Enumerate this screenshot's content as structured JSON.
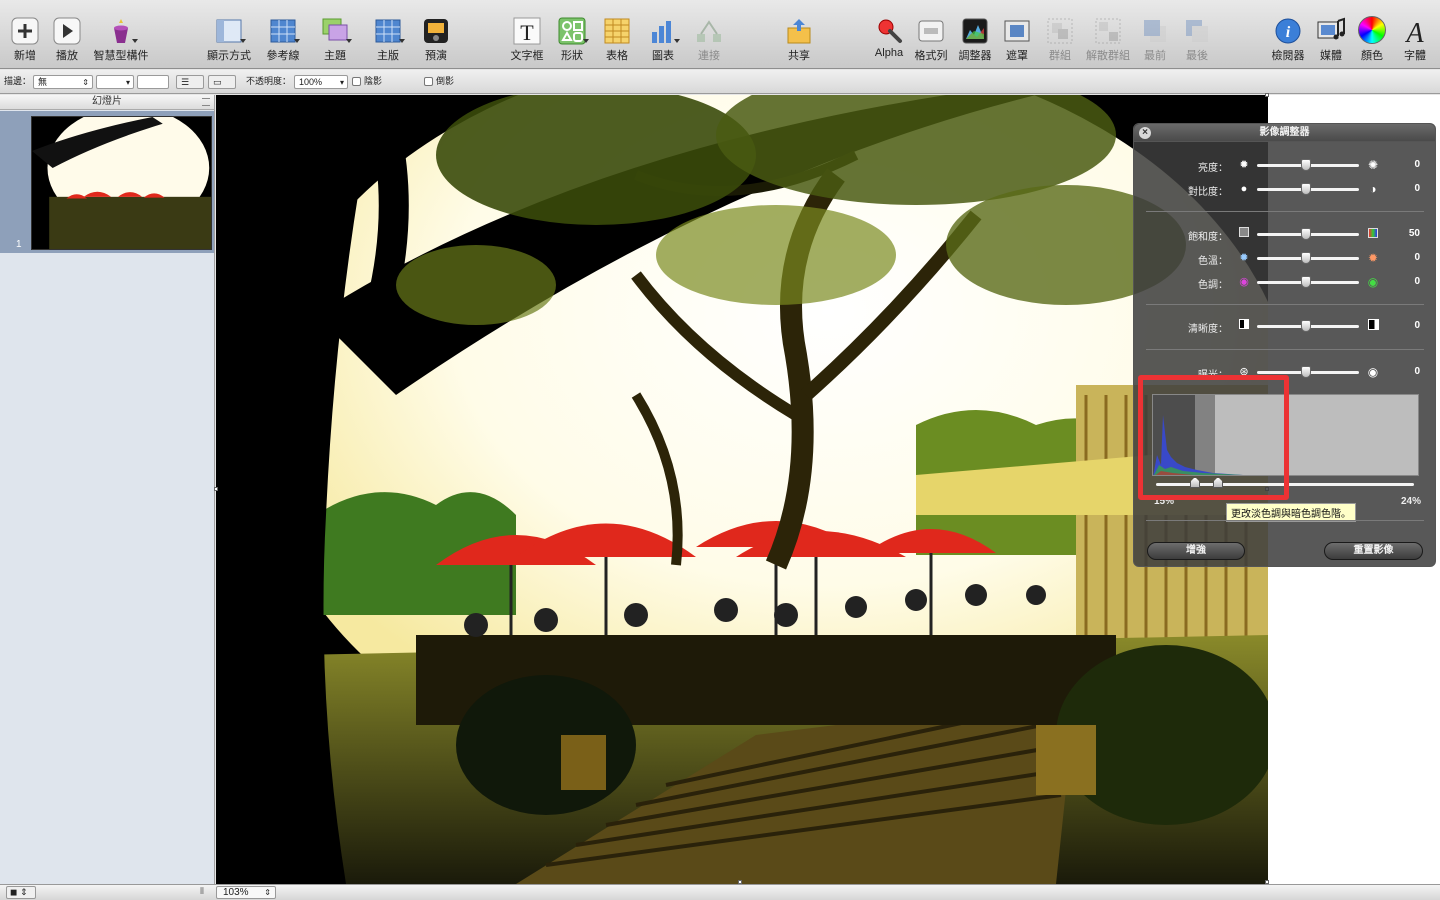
{
  "toolbar": {
    "items": [
      {
        "label": "新增",
        "icon": "plus-icon"
      },
      {
        "label": "播放",
        "icon": "play-icon"
      },
      {
        "label": "智慧型構件",
        "icon": "smart-builds-icon"
      },
      {
        "label": "顯示方式",
        "icon": "view-icon"
      },
      {
        "label": "參考線",
        "icon": "guides-icon"
      },
      {
        "label": "主題",
        "icon": "themes-icon"
      },
      {
        "label": "主版",
        "icon": "masters-icon"
      },
      {
        "label": "預演",
        "icon": "rehearse-icon"
      },
      {
        "label": "文字框",
        "icon": "text-box-icon"
      },
      {
        "label": "形狀",
        "icon": "shapes-icon"
      },
      {
        "label": "表格",
        "icon": "table-icon"
      },
      {
        "label": "圖表",
        "icon": "chart-icon"
      },
      {
        "label": "連接",
        "icon": "connect-icon"
      },
      {
        "label": "共享",
        "icon": "share-icon"
      },
      {
        "label": "Alpha",
        "icon": "alpha-icon"
      },
      {
        "label": "格式列",
        "icon": "format-bar-icon"
      },
      {
        "label": "調整器",
        "icon": "adjust-icon"
      },
      {
        "label": "遮罩",
        "icon": "mask-icon"
      },
      {
        "label": "群組",
        "icon": "group-icon"
      },
      {
        "label": "解散群組",
        "icon": "ungroup-icon"
      },
      {
        "label": "最前",
        "icon": "front-icon"
      },
      {
        "label": "最後",
        "icon": "back-icon"
      },
      {
        "label": "檢閱器",
        "icon": "inspector-icon"
      },
      {
        "label": "媒體",
        "icon": "media-icon"
      },
      {
        "label": "顏色",
        "icon": "colors-icon"
      },
      {
        "label": "字體",
        "icon": "fonts-icon"
      }
    ]
  },
  "formatbar": {
    "stroke_label": "描邊：",
    "stroke_value": "無",
    "opacity_label": "不透明度：",
    "opacity_value": "100%",
    "shadow_label": "陰影",
    "reflection_label": "倒影"
  },
  "navigator": {
    "title": "幻燈片",
    "slide_number": "1"
  },
  "statusbar": {
    "zoom": "103%"
  },
  "adjust_panel": {
    "title": "影像調整器",
    "rows": [
      {
        "label": "亮度：",
        "value": "0",
        "level": 0.5
      },
      {
        "label": "對比度：",
        "value": "0",
        "level": 0.5
      },
      {
        "label": "飽和度：",
        "value": "50",
        "level": 0.5
      },
      {
        "label": "色溫：",
        "value": "0",
        "level": 0.5
      },
      {
        "label": "色調：",
        "value": "0",
        "level": 0.5
      },
      {
        "label": "清晰度：",
        "value": "0",
        "level": 0.5
      },
      {
        "label": "曝光：",
        "value": "0",
        "level": 0.5
      }
    ],
    "levels_left": "15%",
    "levels_right": "24%",
    "tooltip": "更改淡色調與暗色調色階。",
    "enhance_button": "增強",
    "reset_button": "重置影像"
  },
  "colors": {
    "highlight": "#ec3234",
    "umbrella_red": "#e0281c",
    "selection_blue": "#8ea0ba"
  }
}
